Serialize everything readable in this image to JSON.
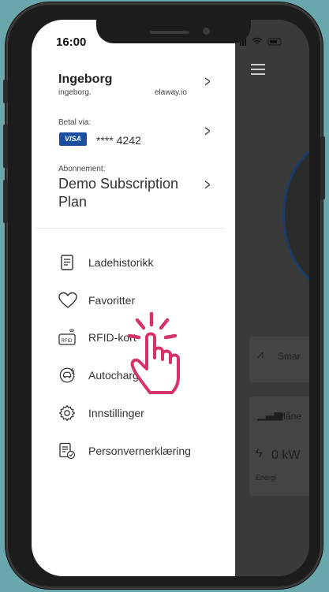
{
  "status_bar": {
    "time": "16:00"
  },
  "profile": {
    "name": "Ingeborg",
    "email_left": "ingeborg.",
    "email_right": "elaway.io"
  },
  "payment": {
    "label": "Betal via:",
    "card_brand": "VISA",
    "card_number": "**** 4242"
  },
  "subscription": {
    "label": "Abonnement:",
    "plan": "Demo Subscription Plan"
  },
  "menu": [
    {
      "label": "Ladehistorikk",
      "icon": "receipt-icon"
    },
    {
      "label": "Favoritter",
      "icon": "heart-icon"
    },
    {
      "label": "RFID-kort",
      "icon": "rfid-card-icon"
    },
    {
      "label": "Autocharge",
      "icon": "car-charge-icon"
    },
    {
      "label": "Innstillinger",
      "icon": "gear-icon"
    },
    {
      "label": "Personvernerklæring",
      "icon": "privacy-document-icon"
    }
  ],
  "background": {
    "card1_label": "Smar",
    "card2_label": "Måne",
    "energy_value": "0 kW",
    "energy_label": "Energi"
  },
  "colors": {
    "visa_blue": "#1a4fa0",
    "tap_hand": "#d6336c",
    "backdrop": "#6aa7ad"
  }
}
